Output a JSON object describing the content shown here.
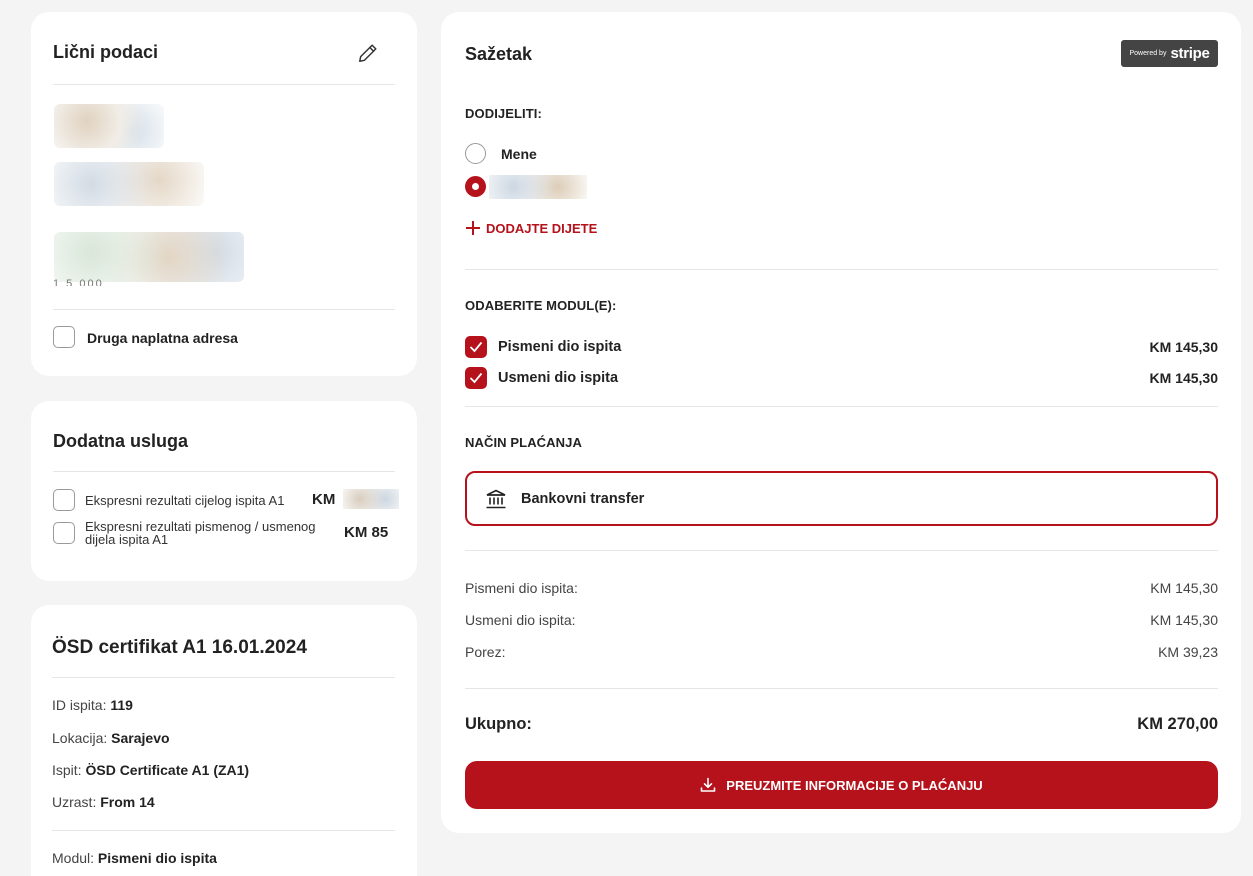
{
  "personal": {
    "title": "Lični podaci",
    "partial_text": "1 5 000",
    "billing_checkbox_label": "Druga naplatna adresa"
  },
  "extra": {
    "title": "Dodatna usluga",
    "options": [
      {
        "label": "Ekspresni rezultati cijelog ispita A1",
        "price": "KM"
      },
      {
        "label_line1": "Ekspresni rezultati pismenog / usmenog",
        "label_line2": "dijela ispita A1",
        "price": "KM 85"
      }
    ]
  },
  "certificate": {
    "title": "ÖSD certifikat A1 16.01.2024",
    "rows": [
      {
        "key": "ID ispita:",
        "value": "119"
      },
      {
        "key": "Lokacija:",
        "value": "Sarajevo"
      },
      {
        "key": "Ispit:",
        "value": "ÖSD Certificate A1 (ZA1)"
      },
      {
        "key": "Uzrast:",
        "value": "From 14"
      }
    ],
    "module": {
      "key": "Modul:",
      "value": "Pismeni dio ispita"
    }
  },
  "summary": {
    "title": "Sažetak",
    "stripe": {
      "powered_by": "Powered by",
      "brand": "stripe"
    },
    "assign_label": "DODIJELITI:",
    "assign_options": [
      {
        "label": "Mene",
        "selected": false
      },
      {
        "label": "",
        "selected": true
      }
    ],
    "add_child_label": "DODAJTE DIJETE",
    "modules_label": "ODABERITE MODUL(E):",
    "modules": [
      {
        "label": "Pismeni dio ispita",
        "price": "KM 145,30",
        "checked": true
      },
      {
        "label": "Usmeni dio ispita",
        "price": "KM 145,30",
        "checked": true
      }
    ],
    "payment_label": "NAČIN PLAĆANJA",
    "payment_method": "Bankovni transfer",
    "lines": [
      {
        "label": "Pismeni dio ispita:",
        "value": "KM 145,30"
      },
      {
        "label": "Usmeni dio ispita:",
        "value": "KM 145,30"
      },
      {
        "label": "Porez:",
        "value": "KM 39,23"
      }
    ],
    "total_label": "Ukupno:",
    "total_value": "KM 270,00",
    "download_label": "PREUZMITE INFORMACIJE O PLAĆANJU"
  },
  "colors": {
    "accent": "#b5121b",
    "background": "#f4f4f5",
    "card": "#ffffff"
  }
}
